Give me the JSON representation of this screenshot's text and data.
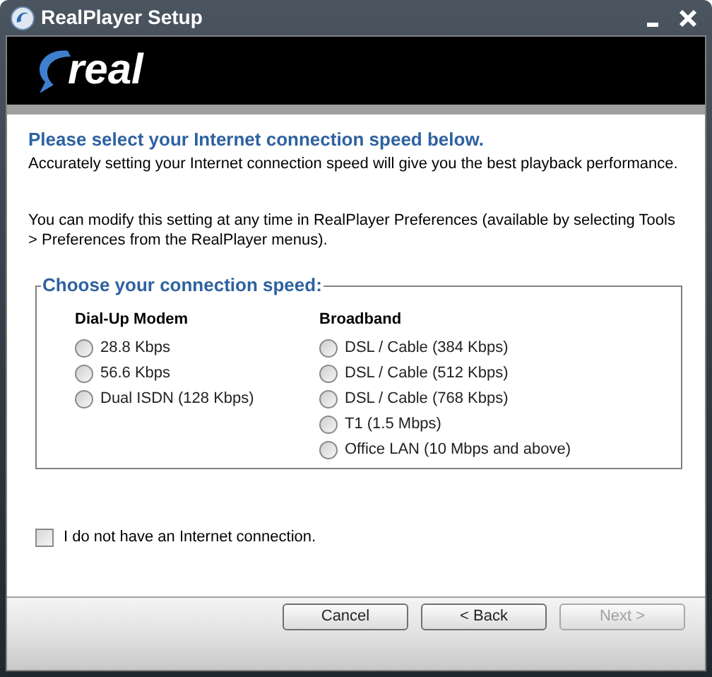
{
  "window": {
    "title": "RealPlayer Setup",
    "controls": [
      {
        "kind": "minimize"
      },
      {
        "kind": "close"
      }
    ]
  },
  "banner": {
    "logo": "real"
  },
  "heading": "Please select your Internet connection speed below.",
  "intro": "Accurately setting your Internet connection speed will give you the best playback performance.",
  "note": "You can modify this setting at any time in RealPlayer Preferences (available by selecting Tools > Preferences from the RealPlayer menus).",
  "speed_group": {
    "legend": "Choose your connection speed:",
    "columns": [
      {
        "heading": "Dial-Up Modem",
        "options": [
          {
            "label": "28.8 Kbps",
            "selected": false
          },
          {
            "label": "56.6 Kbps",
            "selected": false
          },
          {
            "label": "Dual ISDN (128 Kbps)",
            "selected": false
          }
        ]
      },
      {
        "heading": "Broadband",
        "options": [
          {
            "label": "DSL / Cable (384 Kbps)",
            "selected": false
          },
          {
            "label": "DSL / Cable (512 Kbps)",
            "selected": false
          },
          {
            "label": "DSL / Cable (768 Kbps)",
            "selected": false
          },
          {
            "label": "T1 (1.5 Mbps)",
            "selected": false
          },
          {
            "label": "Office LAN (10 Mbps and above)",
            "selected": false
          }
        ]
      }
    ]
  },
  "no_connection": {
    "label": "I do not have an Internet connection.",
    "checked": false
  },
  "buttons": [
    {
      "label": "Cancel",
      "disabled": false
    },
    {
      "label": "< Back",
      "disabled": false
    },
    {
      "label": "Next >",
      "disabled": true
    }
  ]
}
